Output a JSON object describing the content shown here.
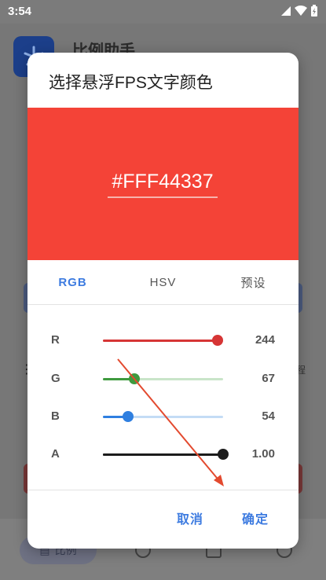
{
  "status": {
    "time": "3:54"
  },
  "background_app": {
    "title": "比例助手",
    "nav_label": "比例",
    "side_text": "程"
  },
  "dialog": {
    "title": "选择悬浮FPS文字颜色",
    "preview_color": "#F44337",
    "hex_value": "#FFF44337",
    "tabs": [
      {
        "label": "RGB",
        "active": true
      },
      {
        "label": "HSV",
        "active": false
      },
      {
        "label": "预设",
        "active": false
      }
    ],
    "sliders": [
      {
        "label": "R",
        "value": "244",
        "fraction": 0.957,
        "color": "#d63535",
        "track_color": "#f2bcbc"
      },
      {
        "label": "G",
        "value": "67",
        "fraction": 0.263,
        "color": "#3f9a3f",
        "track_color": "#c9e5c9"
      },
      {
        "label": "B",
        "value": "54",
        "fraction": 0.212,
        "color": "#2f7fe0",
        "track_color": "#c4dcf5"
      },
      {
        "label": "A",
        "value": "1.00",
        "fraction": 1.0,
        "color": "#1c1c1c",
        "track_color": "#1c1c1c"
      }
    ],
    "cancel_label": "取消",
    "confirm_label": "确定"
  },
  "colors": {
    "accent": "#3d7be0",
    "annotation_arrow": "#e34a2f"
  }
}
